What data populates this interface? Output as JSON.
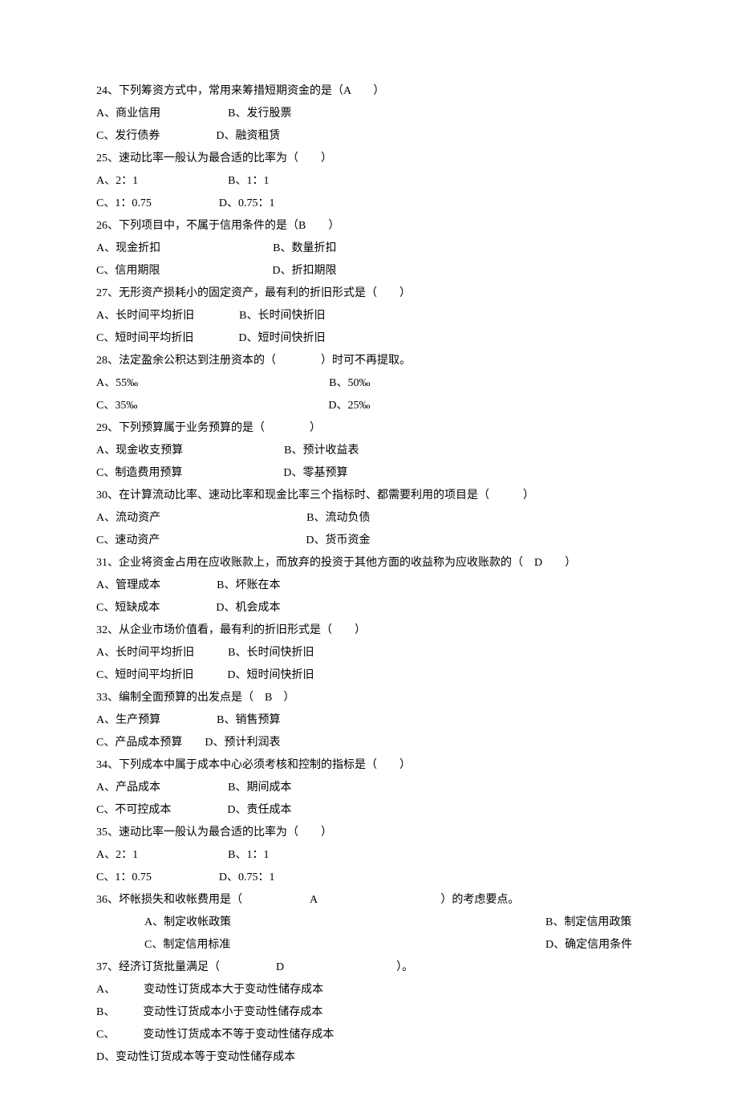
{
  "questions": [
    {
      "num": "24、",
      "text": "下列筹资方式中，常用来筹措短期资金的是（A　　）",
      "optLines": [
        "A、商业信用　　　　　　B、发行股票",
        "C、发行债券　　　　　D、融资租赁"
      ]
    },
    {
      "num": "25、",
      "text": "速动比率一般认为最合适的比率为（　　）",
      "optLines": [
        "A、2：1　　　　　　　　B、1：1",
        "C、1：0.75　　　　　　D、0.75：1"
      ]
    },
    {
      "num": "26、",
      "text": "下列项目中，不属于信用条件的是（B　　）",
      "optLines": [
        "A、现金折扣　　　　　　　　　　B、数量折扣",
        "C、信用期限　　　　　　　　　　D、折扣期限"
      ]
    },
    {
      "num": "27、",
      "text": "无形资产损耗小的固定资产，最有利的折旧形式是（　　）",
      "optLines": [
        "A、长时间平均折旧　　　　B、长时间快折旧",
        "C、短时间平均折旧　　　　D、短时间快折旧"
      ]
    },
    {
      "num": "28、",
      "text": "法定盈余公积达到注册资本的（　　　　）时可不再提取。",
      "optLines": [
        "A、55‰　　　　　　　　　　　　　　　　　B、50‰",
        "C、35‰　　　　　　　　　　　　　　　　　D、25‰"
      ]
    },
    {
      "num": "29、",
      "text": "下列预算属于业务预算的是（　　　　）",
      "optLines": [
        "A、现金收支预算　　　　　　　　　B、预计收益表",
        "C、制造费用预算　　　　　　　　　D、零基预算"
      ]
    },
    {
      "num": "30、",
      "text": "在计算流动比率、速动比率和现金比率三个指标时、都需要利用的项目是（　　　）",
      "optLines": [
        "A、流动资产　　　　　　　　　　　　　B、流动负债",
        "C、速动资产　　　　　　　　　　　　　D、货币资金"
      ]
    },
    {
      "num": "31、",
      "text": "企业将资金占用在应收账款上，而放弃的投资于其他方面的收益称为应收账款的（　D　　）",
      "optLines": [
        "A、管理成本　　　　　B、坏账在本",
        "C、短缺成本　　　　　D、机会成本"
      ]
    },
    {
      "num": "32、",
      "text": "从企业市场价值看，最有利的折旧形式是（　　）",
      "optLines": [
        "A、长时间平均折旧　　　B、长时间快折旧",
        "C、短时间平均折旧　　　D、短时间快折旧"
      ]
    },
    {
      "num": "33、",
      "text": "编制全面预算的出发点是（　B　）",
      "optLines": [
        "A、生产预算　　　　　B、销售预算",
        "C、产品成本预算　　D、预计利润表"
      ]
    },
    {
      "num": "34、",
      "text": "下列成本中属于成本中心必须考核和控制的指标是（　　）",
      "optLines": [
        "A、产品成本　　　　　　B、期间成本",
        "C、不可控成本　　　　　D、责任成本"
      ]
    },
    {
      "num": "35、",
      "text": "速动比率一般认为最合适的比率为（　　）",
      "optLines": [
        "A、2：1　　　　　　　　B、1：1",
        "C、1：0.75　　　　　　D、0.75：1"
      ]
    },
    {
      "num": "36、",
      "text": "坏帐损失和收帐费用是（　　　　　　A　　　　　　　　　　　）的考虑要点。",
      "optLinesSpecial": [
        {
          "left": "A、制定收帐政策",
          "right": "B、制定信用政策"
        },
        {
          "left": "C、制定信用标准",
          "right": "D、确定信用条件"
        }
      ]
    },
    {
      "num": "37、",
      "text": "经济订货批量满足（　　　　　D　　　　　　　　　　）。",
      "optLinesPlain": [
        "A、　　　变动性订货成本大于变动性储存成本",
        "B、　　　变动性订货成本小于变动性储存成本",
        "C、　　　变动性订货成本不等于变动性储存成本",
        "D、变动性订货成本等于变动性储存成本"
      ]
    }
  ]
}
